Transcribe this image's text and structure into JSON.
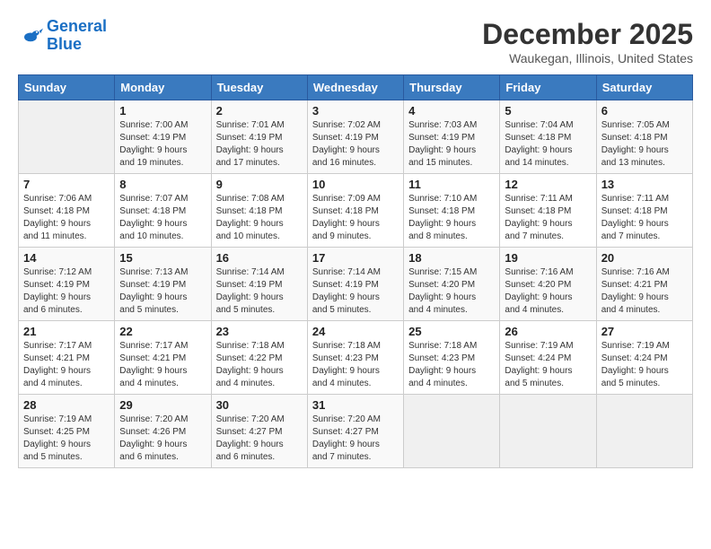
{
  "header": {
    "logo_line1": "General",
    "logo_line2": "Blue",
    "month": "December 2025",
    "location": "Waukegan, Illinois, United States"
  },
  "weekdays": [
    "Sunday",
    "Monday",
    "Tuesday",
    "Wednesday",
    "Thursday",
    "Friday",
    "Saturday"
  ],
  "weeks": [
    [
      {
        "day": "",
        "info": ""
      },
      {
        "day": "1",
        "info": "Sunrise: 7:00 AM\nSunset: 4:19 PM\nDaylight: 9 hours\nand 19 minutes."
      },
      {
        "day": "2",
        "info": "Sunrise: 7:01 AM\nSunset: 4:19 PM\nDaylight: 9 hours\nand 17 minutes."
      },
      {
        "day": "3",
        "info": "Sunrise: 7:02 AM\nSunset: 4:19 PM\nDaylight: 9 hours\nand 16 minutes."
      },
      {
        "day": "4",
        "info": "Sunrise: 7:03 AM\nSunset: 4:19 PM\nDaylight: 9 hours\nand 15 minutes."
      },
      {
        "day": "5",
        "info": "Sunrise: 7:04 AM\nSunset: 4:18 PM\nDaylight: 9 hours\nand 14 minutes."
      },
      {
        "day": "6",
        "info": "Sunrise: 7:05 AM\nSunset: 4:18 PM\nDaylight: 9 hours\nand 13 minutes."
      }
    ],
    [
      {
        "day": "7",
        "info": "Sunrise: 7:06 AM\nSunset: 4:18 PM\nDaylight: 9 hours\nand 11 minutes."
      },
      {
        "day": "8",
        "info": "Sunrise: 7:07 AM\nSunset: 4:18 PM\nDaylight: 9 hours\nand 10 minutes."
      },
      {
        "day": "9",
        "info": "Sunrise: 7:08 AM\nSunset: 4:18 PM\nDaylight: 9 hours\nand 10 minutes."
      },
      {
        "day": "10",
        "info": "Sunrise: 7:09 AM\nSunset: 4:18 PM\nDaylight: 9 hours\nand 9 minutes."
      },
      {
        "day": "11",
        "info": "Sunrise: 7:10 AM\nSunset: 4:18 PM\nDaylight: 9 hours\nand 8 minutes."
      },
      {
        "day": "12",
        "info": "Sunrise: 7:11 AM\nSunset: 4:18 PM\nDaylight: 9 hours\nand 7 minutes."
      },
      {
        "day": "13",
        "info": "Sunrise: 7:11 AM\nSunset: 4:18 PM\nDaylight: 9 hours\nand 7 minutes."
      }
    ],
    [
      {
        "day": "14",
        "info": "Sunrise: 7:12 AM\nSunset: 4:19 PM\nDaylight: 9 hours\nand 6 minutes."
      },
      {
        "day": "15",
        "info": "Sunrise: 7:13 AM\nSunset: 4:19 PM\nDaylight: 9 hours\nand 5 minutes."
      },
      {
        "day": "16",
        "info": "Sunrise: 7:14 AM\nSunset: 4:19 PM\nDaylight: 9 hours\nand 5 minutes."
      },
      {
        "day": "17",
        "info": "Sunrise: 7:14 AM\nSunset: 4:19 PM\nDaylight: 9 hours\nand 5 minutes."
      },
      {
        "day": "18",
        "info": "Sunrise: 7:15 AM\nSunset: 4:20 PM\nDaylight: 9 hours\nand 4 minutes."
      },
      {
        "day": "19",
        "info": "Sunrise: 7:16 AM\nSunset: 4:20 PM\nDaylight: 9 hours\nand 4 minutes."
      },
      {
        "day": "20",
        "info": "Sunrise: 7:16 AM\nSunset: 4:21 PM\nDaylight: 9 hours\nand 4 minutes."
      }
    ],
    [
      {
        "day": "21",
        "info": "Sunrise: 7:17 AM\nSunset: 4:21 PM\nDaylight: 9 hours\nand 4 minutes."
      },
      {
        "day": "22",
        "info": "Sunrise: 7:17 AM\nSunset: 4:21 PM\nDaylight: 9 hours\nand 4 minutes."
      },
      {
        "day": "23",
        "info": "Sunrise: 7:18 AM\nSunset: 4:22 PM\nDaylight: 9 hours\nand 4 minutes."
      },
      {
        "day": "24",
        "info": "Sunrise: 7:18 AM\nSunset: 4:23 PM\nDaylight: 9 hours\nand 4 minutes."
      },
      {
        "day": "25",
        "info": "Sunrise: 7:18 AM\nSunset: 4:23 PM\nDaylight: 9 hours\nand 4 minutes."
      },
      {
        "day": "26",
        "info": "Sunrise: 7:19 AM\nSunset: 4:24 PM\nDaylight: 9 hours\nand 5 minutes."
      },
      {
        "day": "27",
        "info": "Sunrise: 7:19 AM\nSunset: 4:24 PM\nDaylight: 9 hours\nand 5 minutes."
      }
    ],
    [
      {
        "day": "28",
        "info": "Sunrise: 7:19 AM\nSunset: 4:25 PM\nDaylight: 9 hours\nand 5 minutes."
      },
      {
        "day": "29",
        "info": "Sunrise: 7:20 AM\nSunset: 4:26 PM\nDaylight: 9 hours\nand 6 minutes."
      },
      {
        "day": "30",
        "info": "Sunrise: 7:20 AM\nSunset: 4:27 PM\nDaylight: 9 hours\nand 6 minutes."
      },
      {
        "day": "31",
        "info": "Sunrise: 7:20 AM\nSunset: 4:27 PM\nDaylight: 9 hours\nand 7 minutes."
      },
      {
        "day": "",
        "info": ""
      },
      {
        "day": "",
        "info": ""
      },
      {
        "day": "",
        "info": ""
      }
    ]
  ]
}
